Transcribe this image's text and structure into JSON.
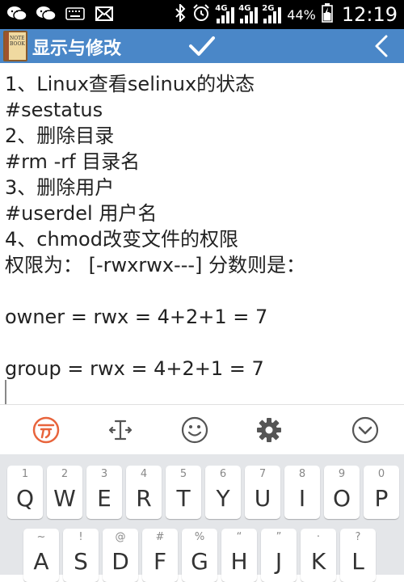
{
  "status_bar": {
    "battery": "44%",
    "time": "12:19",
    "signal1_label": "4G",
    "signal2_label": "4G",
    "signal3_label": "2G"
  },
  "app_bar": {
    "title": "显示与修改",
    "icon_text": "NOTE BOOK",
    "bg_color": "#4a87c8"
  },
  "editor": {
    "lines": [
      "1、Linux查看selinux的状态",
      "#sestatus",
      "2、删除目录",
      "#rm -rf 目录名",
      "3、删除用户",
      "#userdel 用户名",
      "4、chmod改变文件的权限",
      "权限为： [-rwxrwx---] 分数则是：",
      "",
      "owner = rwx = 4+2+1 = 7",
      "",
      "group = rwx = 4+2+1 = 7"
    ]
  },
  "keyboard_toolbar": {
    "items": [
      "sogou-logo-icon",
      "cursor-move-icon",
      "emoji-icon",
      "settings-icon",
      "collapse-icon"
    ],
    "accent_color": "#e8643c"
  },
  "keyboard": {
    "row1": [
      {
        "hint": "1",
        "key": "Q"
      },
      {
        "hint": "2",
        "key": "W"
      },
      {
        "hint": "3",
        "key": "E"
      },
      {
        "hint": "4",
        "key": "R"
      },
      {
        "hint": "5",
        "key": "T"
      },
      {
        "hint": "6",
        "key": "Y"
      },
      {
        "hint": "7",
        "key": "U"
      },
      {
        "hint": "8",
        "key": "I"
      },
      {
        "hint": "9",
        "key": "O"
      },
      {
        "hint": "0",
        "key": "P"
      }
    ],
    "row2": [
      {
        "hint": "~",
        "key": "A"
      },
      {
        "hint": "!",
        "key": "S"
      },
      {
        "hint": "@",
        "key": "D"
      },
      {
        "hint": "#",
        "key": "F"
      },
      {
        "hint": "%",
        "key": "G"
      },
      {
        "hint": "“",
        "key": "H"
      },
      {
        "hint": "”",
        "key": "J"
      },
      {
        "hint": "·",
        "key": "K"
      },
      {
        "hint": "?",
        "key": "L"
      }
    ]
  }
}
